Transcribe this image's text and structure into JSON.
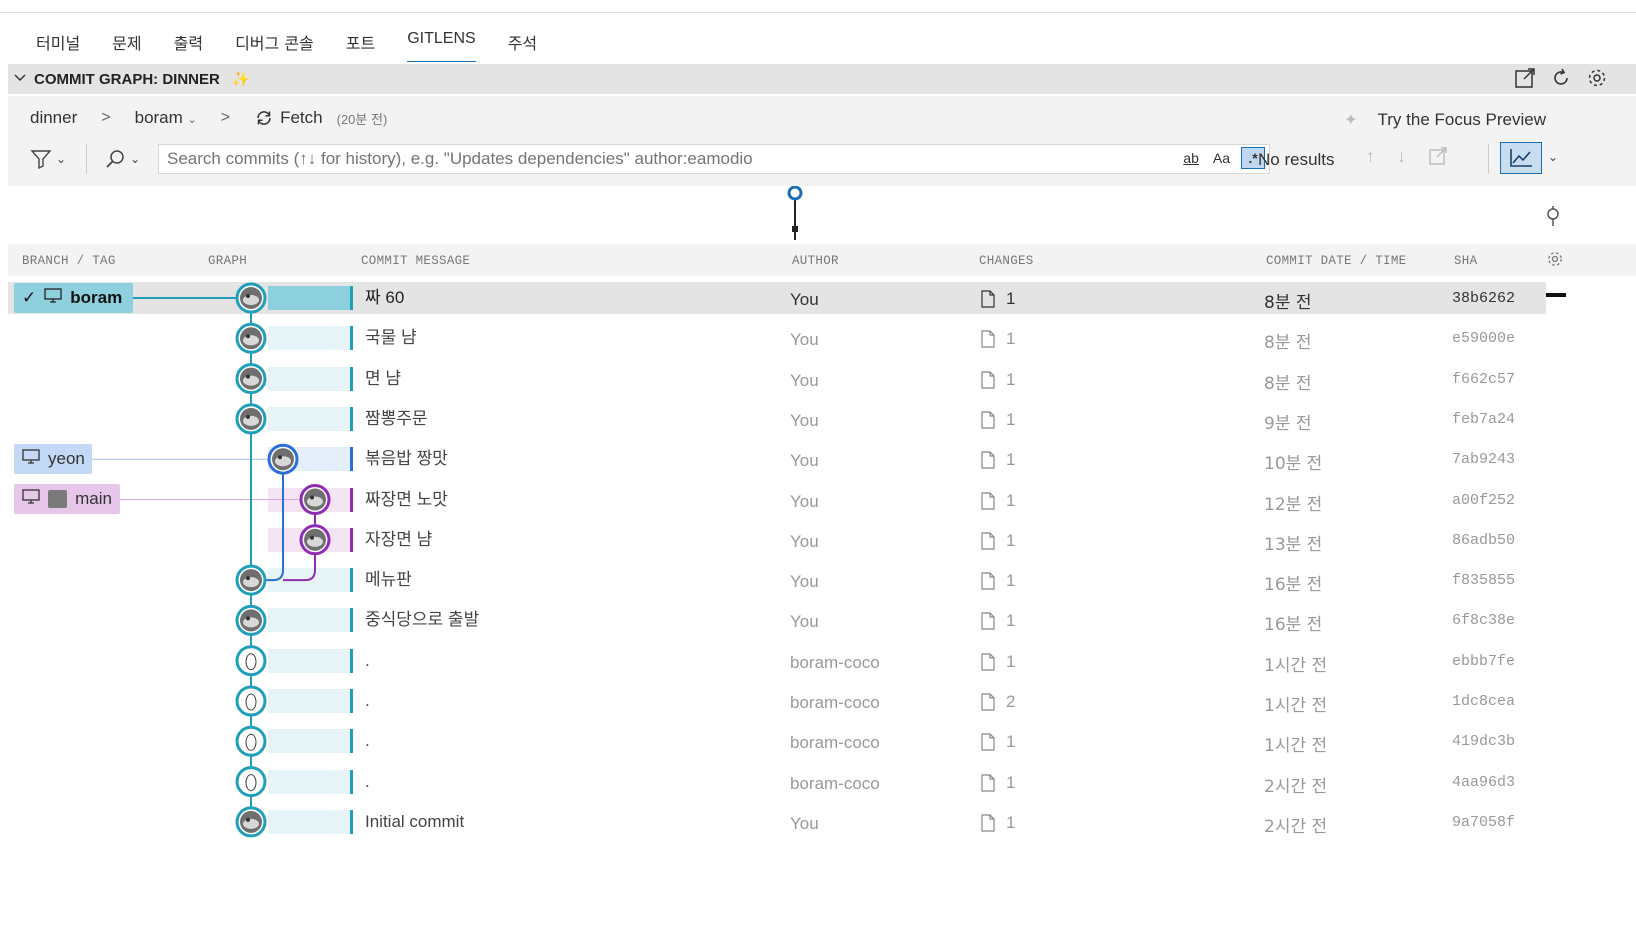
{
  "tabs": [
    {
      "label": "터미널"
    },
    {
      "label": "문제"
    },
    {
      "label": "출력"
    },
    {
      "label": "디버그 콘솔"
    },
    {
      "label": "포트"
    },
    {
      "label": "GITLENS"
    },
    {
      "label": "주석"
    }
  ],
  "active_tab": "GITLENS",
  "panel": {
    "title": "COMMIT GRAPH: DINNER"
  },
  "breadcrumb": {
    "repo": "dinner",
    "branch": "boram",
    "fetch_label": "Fetch",
    "fetch_time": "(20분 전)"
  },
  "focus_preview": "Try the Focus Preview",
  "search": {
    "placeholder": "Search commits (↑↓ for history), e.g. \"Updates dependencies\" author:eamodio",
    "opt_word": "ab",
    "opt_case": "Aa",
    "opt_regex": ".*",
    "results": "No results"
  },
  "columns": {
    "branch_tag": "BRANCH / TAG",
    "graph": "GRAPH",
    "message": "COMMIT MESSAGE",
    "author": "AUTHOR",
    "changes": "CHANGES",
    "date": "COMMIT DATE / TIME",
    "sha": "SHA"
  },
  "branch_labels": [
    {
      "name": "boram",
      "checked": true,
      "color": "#8fd0de"
    },
    {
      "name": "yeon",
      "checked": false,
      "color": "#c3d9f6"
    },
    {
      "name": "main",
      "checked": false,
      "color": "#e6c7ea"
    }
  ],
  "commits": [
    {
      "message": "짜 60",
      "author": "You",
      "changes": "1",
      "date": "8분 전",
      "sha": "38b6262"
    },
    {
      "message": "국물 냠",
      "author": "You",
      "changes": "1",
      "date": "8분 전",
      "sha": "e59000e"
    },
    {
      "message": "면 냠",
      "author": "You",
      "changes": "1",
      "date": "8분 전",
      "sha": "f662c57"
    },
    {
      "message": "짬뽕주문",
      "author": "You",
      "changes": "1",
      "date": "9분 전",
      "sha": "feb7a24"
    },
    {
      "message": "볶음밥 짱맛",
      "author": "You",
      "changes": "1",
      "date": "10분 전",
      "sha": "7ab9243"
    },
    {
      "message": "짜장면 노맛",
      "author": "You",
      "changes": "1",
      "date": "12분 전",
      "sha": "a00f252"
    },
    {
      "message": "자장면 냠",
      "author": "You",
      "changes": "1",
      "date": "13분 전",
      "sha": "86adb50"
    },
    {
      "message": "메뉴판",
      "author": "You",
      "changes": "1",
      "date": "16분 전",
      "sha": "f835855"
    },
    {
      "message": "중식당으로 출발",
      "author": "You",
      "changes": "1",
      "date": "16분 전",
      "sha": "6f8c38e"
    },
    {
      "message": ".",
      "author": "boram-coco",
      "changes": "1",
      "date": "1시간 전",
      "sha": "ebbb7fe"
    },
    {
      "message": ".",
      "author": "boram-coco",
      "changes": "2",
      "date": "1시간 전",
      "sha": "1dc8cea"
    },
    {
      "message": ".",
      "author": "boram-coco",
      "changes": "1",
      "date": "1시간 전",
      "sha": "419dc3b"
    },
    {
      "message": ".",
      "author": "boram-coco",
      "changes": "1",
      "date": "2시간 전",
      "sha": "4aa96d3"
    },
    {
      "message": "Initial commit",
      "author": "You",
      "changes": "1",
      "date": "2시간 전",
      "sha": "9a7058f"
    }
  ],
  "colors": {
    "boram": "#1f9fb9",
    "yeon": "#2b6fd6",
    "main": "#8e2db3",
    "accent": "#1a6fb5"
  }
}
